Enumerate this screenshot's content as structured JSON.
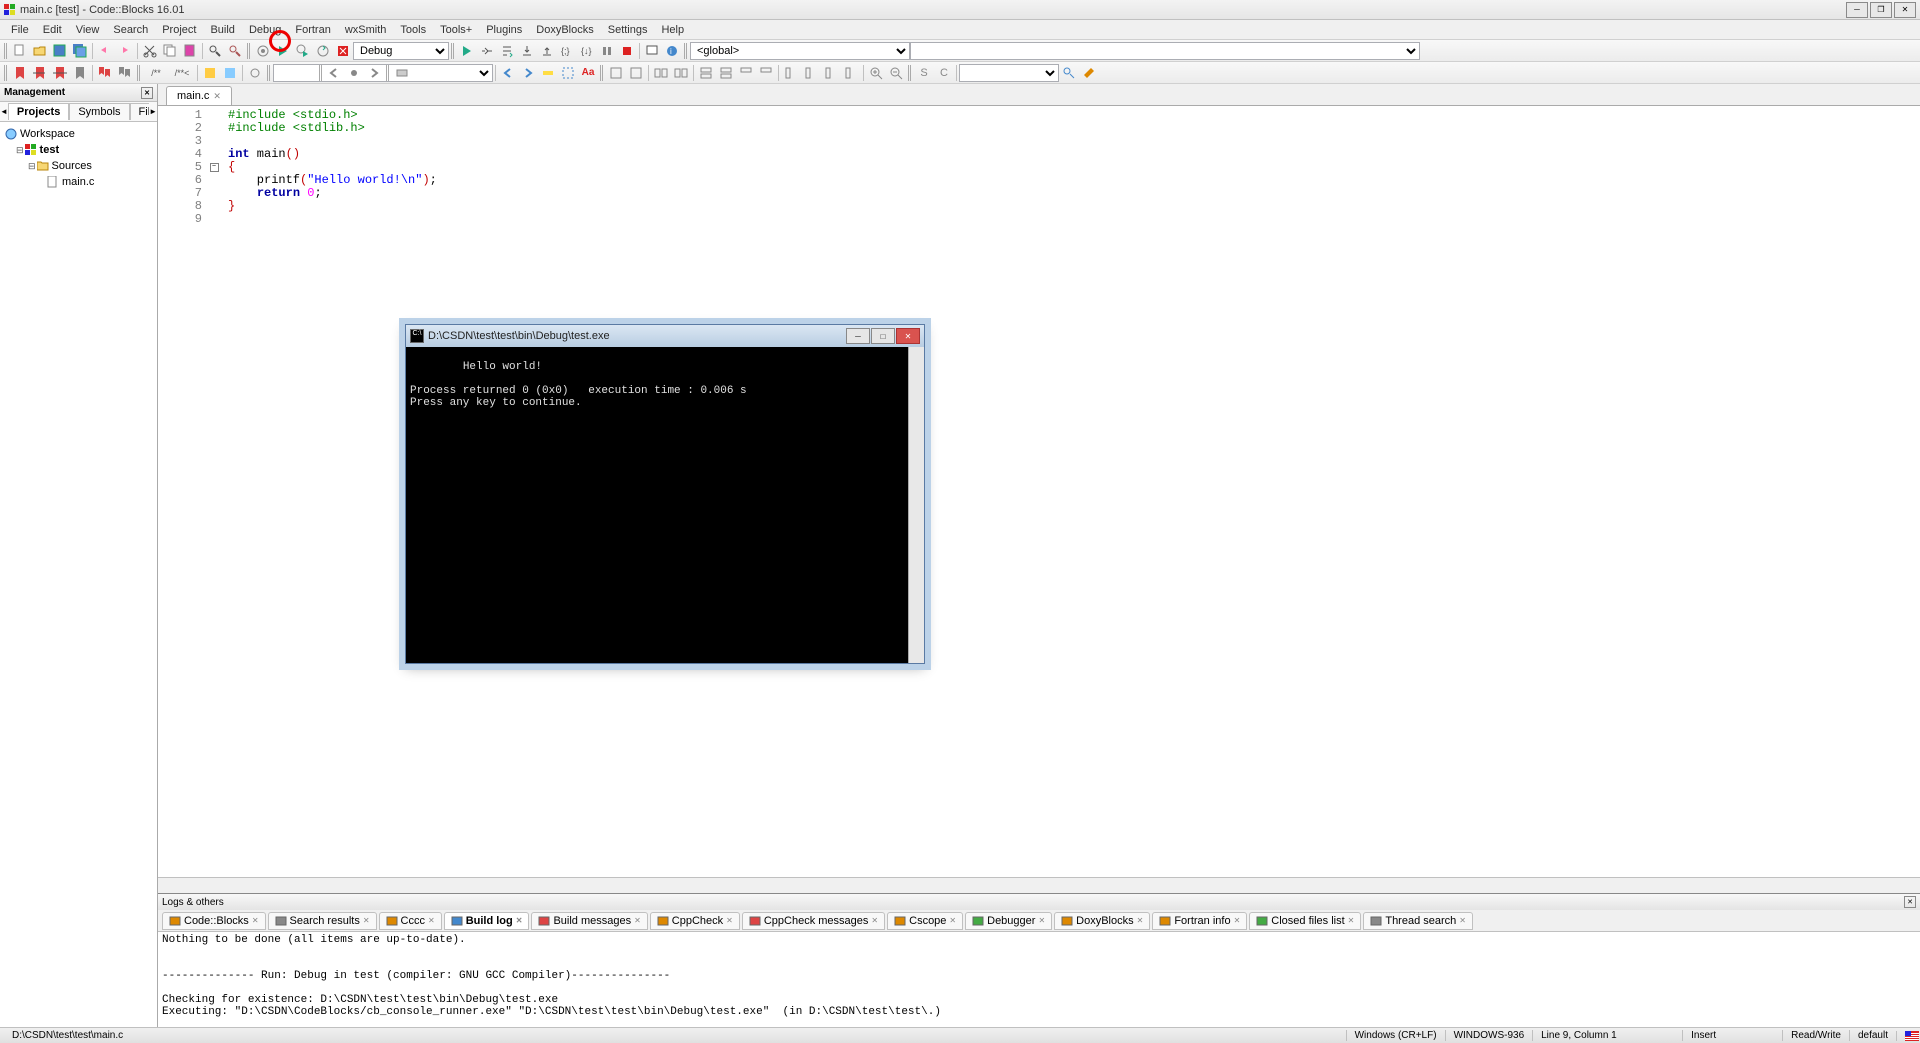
{
  "window": {
    "title": "main.c [test] - Code::Blocks 16.01"
  },
  "menu": [
    "File",
    "Edit",
    "View",
    "Search",
    "Project",
    "Build",
    "Debug",
    "Fortran",
    "wxSmith",
    "Tools",
    "Tools+",
    "Plugins",
    "DoxyBlocks",
    "Settings",
    "Help"
  ],
  "toolbar": {
    "build_target": "Debug",
    "scope": "<global>"
  },
  "management": {
    "title": "Management",
    "tabs": [
      "Projects",
      "Symbols",
      "Files"
    ],
    "active_tab": "Projects",
    "tree": {
      "workspace": "Workspace",
      "project": "test",
      "sources": "Sources",
      "file": "main.c"
    }
  },
  "editor": {
    "tab": "main.c",
    "lines": [
      {
        "n": "1",
        "html": "<span class='kw-green'>#include &lt;stdio.h&gt;</span>"
      },
      {
        "n": "2",
        "html": "<span class='kw-green'>#include &lt;stdlib.h&gt;</span>"
      },
      {
        "n": "3",
        "html": ""
      },
      {
        "n": "4",
        "html": "<span class='kw-blue'>int</span> main<span class='kw-red'>()</span>"
      },
      {
        "n": "5",
        "html": "<span class='kw-red'>{</span>"
      },
      {
        "n": "6",
        "html": "    printf<span class='kw-red'>(</span><span class='kw-str'>\"Hello world!\\n\"</span><span class='kw-red'>)</span>;"
      },
      {
        "n": "7",
        "html": "    <span class='kw-blue'>return</span> <span class='kw-num'>0</span>;"
      },
      {
        "n": "8",
        "html": "<span class='kw-red'>}</span>"
      },
      {
        "n": "9",
        "html": ""
      }
    ]
  },
  "console": {
    "title": "D:\\CSDN\\test\\test\\bin\\Debug\\test.exe",
    "output": "Hello world!\n\nProcess returned 0 (0x0)   execution time : 0.006 s\nPress any key to continue."
  },
  "logs": {
    "title": "Logs & others",
    "tabs": [
      "Code::Blocks",
      "Search results",
      "Cccc",
      "Build log",
      "Build messages",
      "CppCheck",
      "CppCheck messages",
      "Cscope",
      "Debugger",
      "DoxyBlocks",
      "Fortran info",
      "Closed files list",
      "Thread search"
    ],
    "active_tab": "Build log",
    "content": "Nothing to be done (all items are up-to-date).\n\n\n-------------- Run: Debug in test (compiler: GNU GCC Compiler)---------------\n\nChecking for existence: D:\\CSDN\\test\\test\\bin\\Debug\\test.exe\nExecuting: \"D:\\CSDN\\CodeBlocks/cb_console_runner.exe\" \"D:\\CSDN\\test\\test\\bin\\Debug\\test.exe\"  (in D:\\CSDN\\test\\test\\.)"
  },
  "status": {
    "path": "D:\\CSDN\\test\\test\\main.c",
    "eol": "Windows (CR+LF)",
    "encoding": "WINDOWS-936",
    "position": "Line 9, Column 1",
    "insert": "Insert",
    "rw": "Read/Write",
    "profile": "default"
  }
}
